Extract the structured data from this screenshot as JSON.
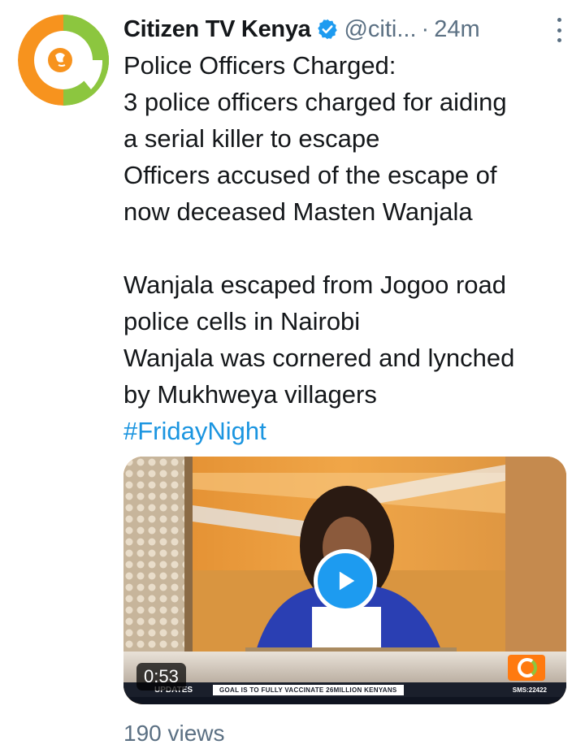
{
  "author": {
    "display_name": "Citizen TV Kenya",
    "handle": "@citi...",
    "separator": "·",
    "time": "24m",
    "verified": true,
    "avatar_icon": "citizen-tv-logo-icon",
    "avatar_colors": {
      "orange": "#f7931e",
      "green": "#8cc63f"
    }
  },
  "tweet": {
    "lines": [
      "Police Officers Charged:",
      "3 police officers charged for aiding",
      "a serial killer to escape",
      "Officers accused of the escape of",
      "now deceased Masten Wanjala",
      "",
      "Wanjala escaped from Jogoo road",
      "police cells in Nairobi",
      "Wanjala was cornered and lynched",
      "by Mukhweya villagers"
    ],
    "hashtag": "#FridayNight"
  },
  "video": {
    "duration": "0:53",
    "ticker_tag": "UPDATES",
    "ticker_text": "GOAL IS TO FULLY VACCINATE 26MILLION KENYANS",
    "ticker_sms": "SMS:22422"
  },
  "stats": {
    "views": "190 views"
  },
  "colors": {
    "link": "#1b95e0",
    "secondary_text": "#5b7083",
    "play_button": "#1d9bf0"
  }
}
